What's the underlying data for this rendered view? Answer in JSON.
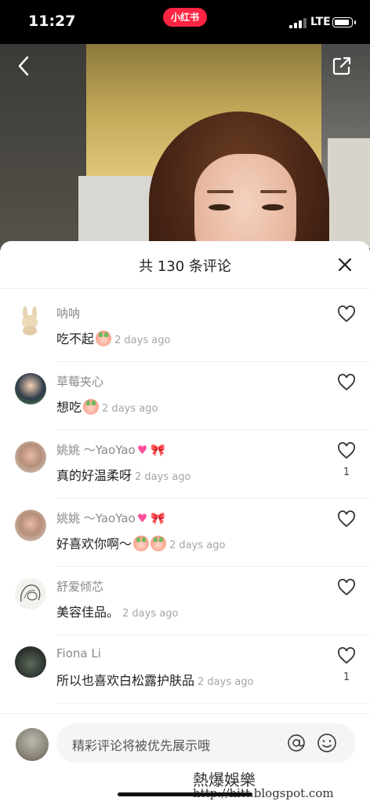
{
  "status": {
    "time": "11:27",
    "app_badge": "小红书",
    "network": "LTE"
  },
  "sheet": {
    "title": "共 130 条评论"
  },
  "comments": [
    {
      "user": "呐呐",
      "text": "吃不起",
      "emoji": "crying-peach",
      "time": "2 days ago",
      "likes": ""
    },
    {
      "user": "草莓夹心",
      "text": "想吃",
      "emoji": "peach-face",
      "time": "2 days ago",
      "likes": ""
    },
    {
      "user": "姚姚 ～YaoYao",
      "text": "真的好温柔呀",
      "emoji": "",
      "time": "2 days ago",
      "likes": "1"
    },
    {
      "user": "姚姚 ～YaoYao",
      "text": "好喜欢你啊～",
      "emoji": "peach-face x2",
      "time": "2 days ago",
      "likes": ""
    },
    {
      "user": "舒爱倾芯",
      "text": "美容佳品。",
      "emoji": "",
      "time": "2 days ago",
      "likes": ""
    },
    {
      "user": "Fiona Li",
      "text": "所以也喜欢白松露护肤品",
      "emoji": "",
      "time": "2 days ago",
      "likes": "1"
    }
  ],
  "input": {
    "placeholder": "精彩评论将被优先展示哦"
  },
  "watermark": {
    "line1": "熱爆娛樂",
    "line2": "http://hitt.blogspot.com"
  },
  "colors": {
    "brand": "#ff2442",
    "text": "#222222",
    "muted": "#8a8a8a"
  }
}
